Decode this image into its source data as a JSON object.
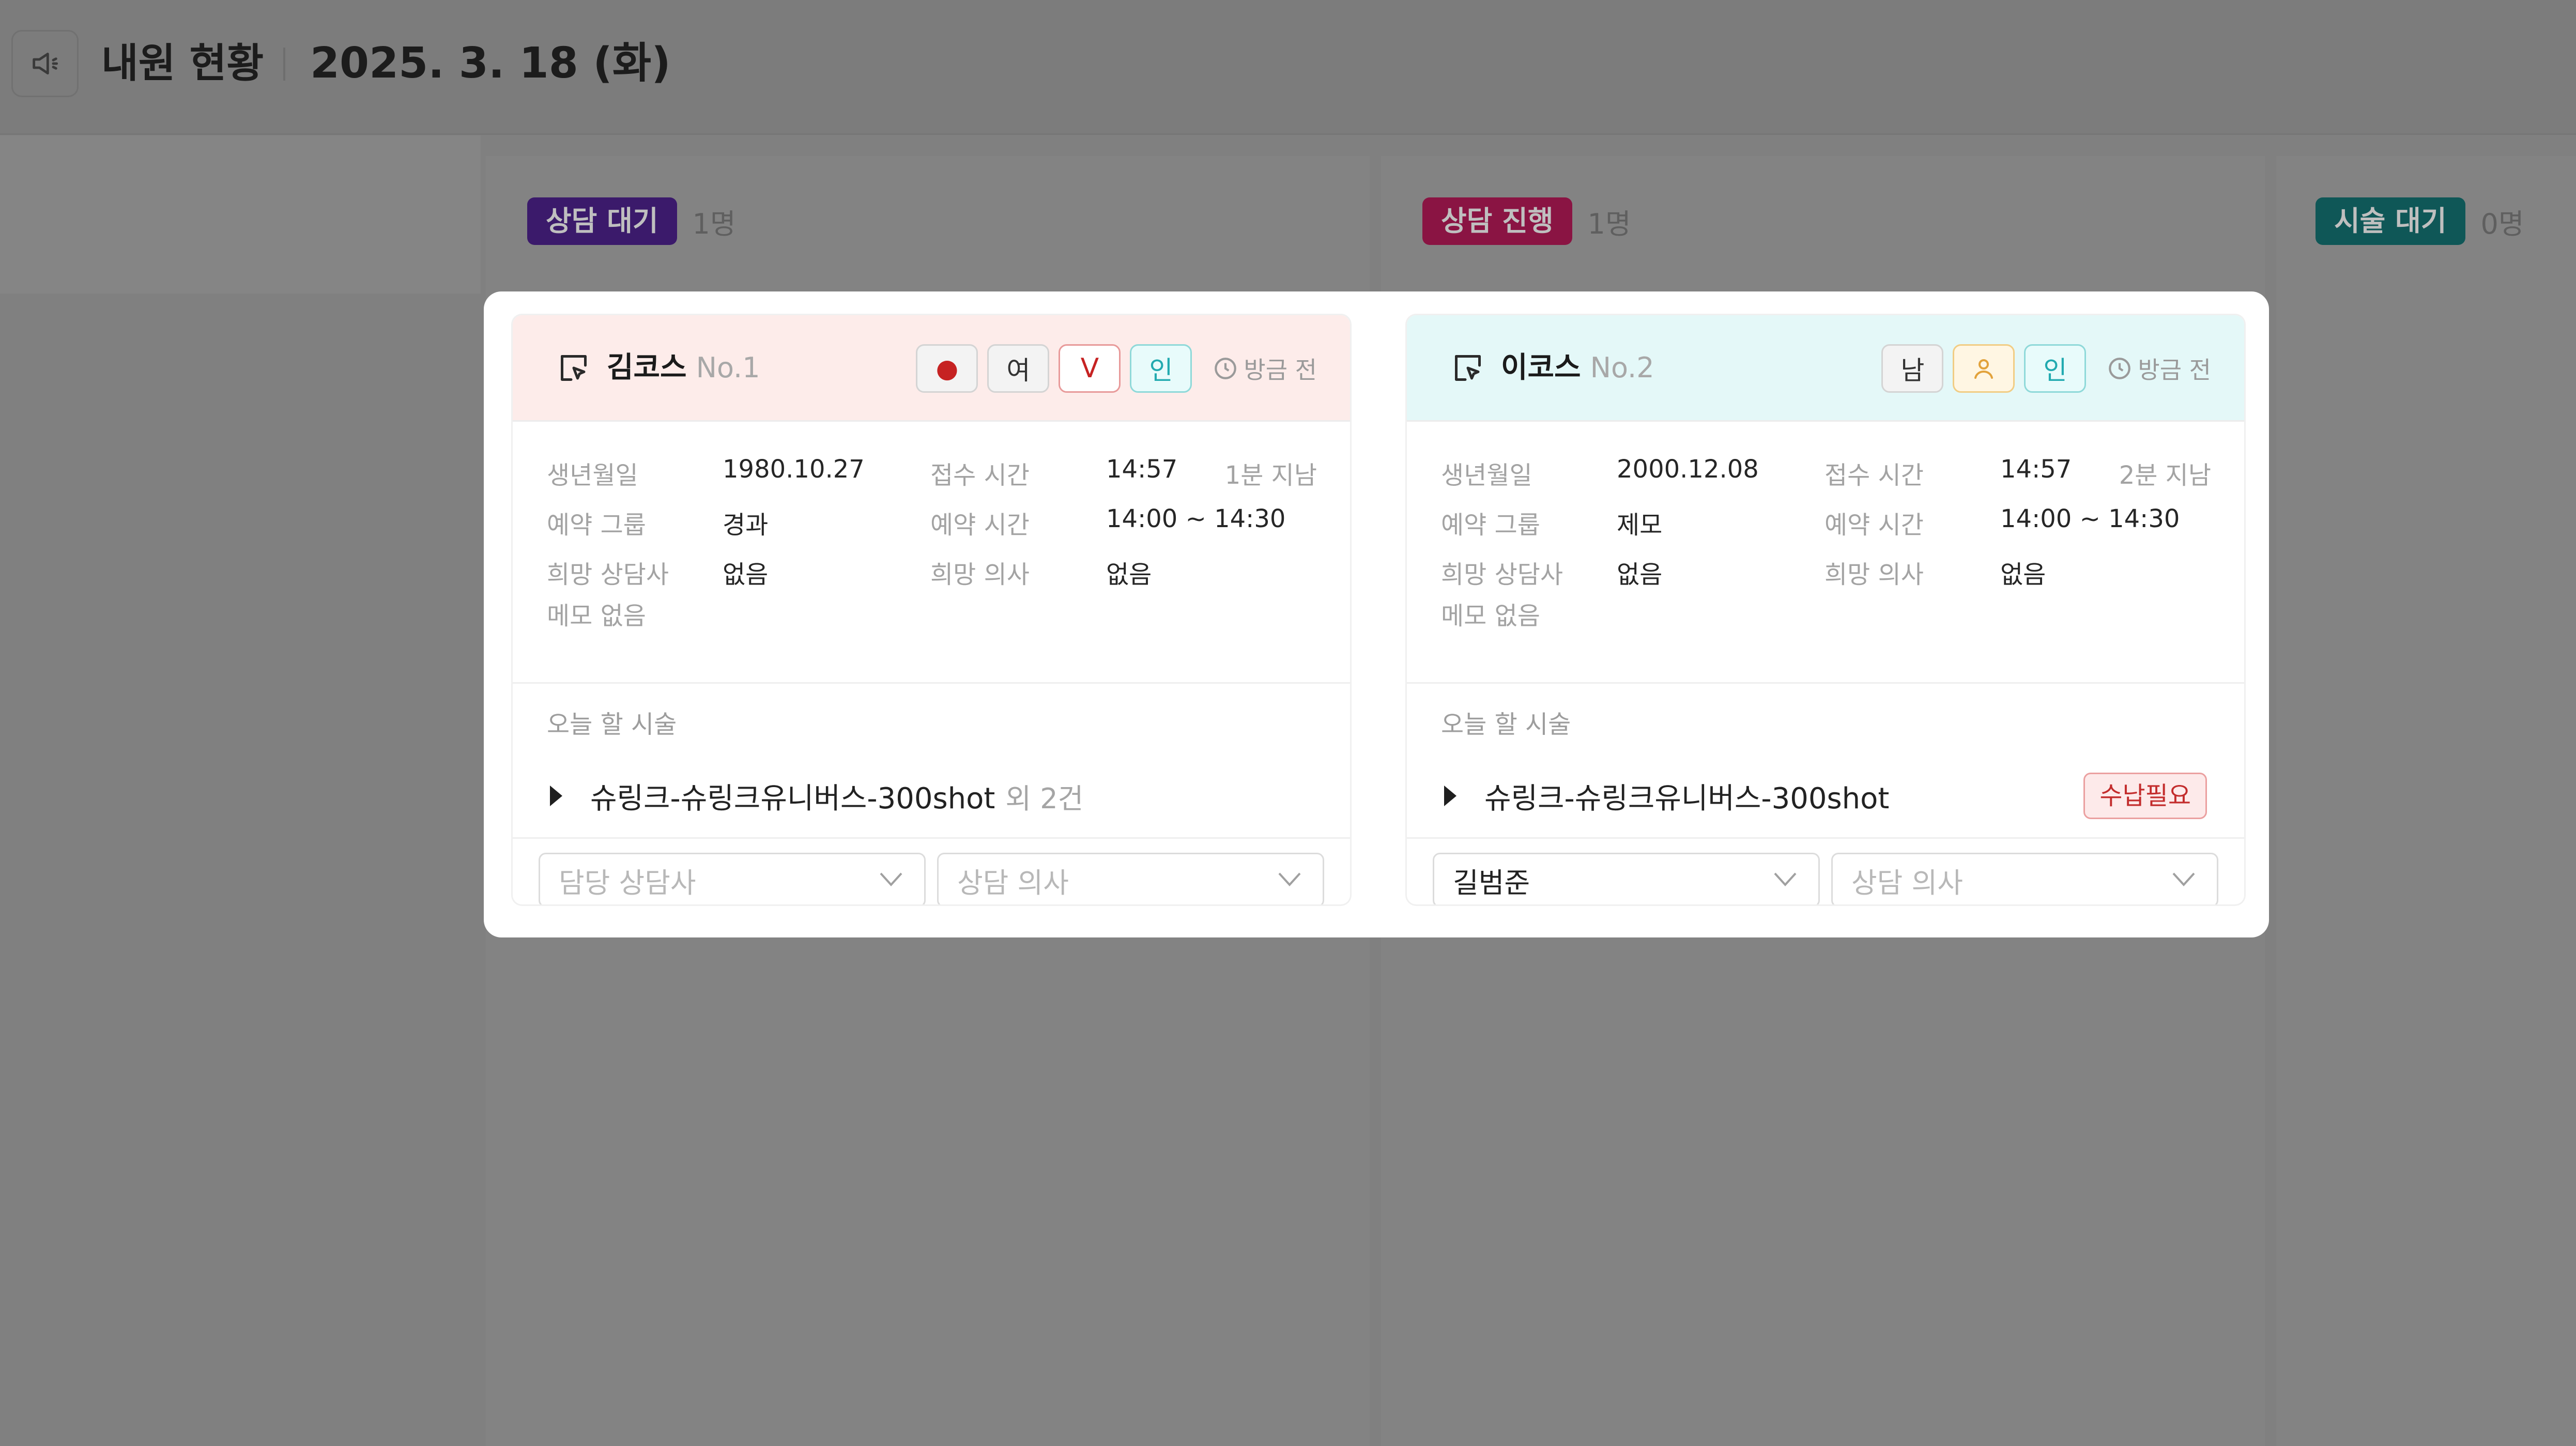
{
  "header": {
    "title": "내원 현황",
    "date": "2025. 3. 18 (화)"
  },
  "columns": [
    {
      "status": "상담 대기",
      "count": "1명",
      "color": "#3b1a6b"
    },
    {
      "status": "상담 진행",
      "count": "1명",
      "color": "#8a1443"
    },
    {
      "status": "시술 대기",
      "count": "0명",
      "color": "#0f5757"
    }
  ],
  "cards": [
    {
      "name": "김코스",
      "no": "No.1",
      "tags": [
        "●",
        "여",
        "V",
        "인"
      ],
      "time_ago": "방금 전",
      "birth_label": "생년월일",
      "birth": "1980.10.27",
      "receipt_label": "접수 시간",
      "receipt": "14:57",
      "receipt_elapsed": "1분 지남",
      "group_label": "예약 그룹",
      "group": "경과",
      "reserve_label": "예약 시간",
      "reserve": "14:00 ~ 14:30",
      "counselor_label": "희망 상담사",
      "counselor": "없음",
      "doctor_label": "희망 의사",
      "doctor": "없음",
      "memo": "메모 없음",
      "today_label": "오늘 할 시술",
      "procedure": "슈링크-슈링크유니버스-300shot",
      "procedure_extra": "외 2건",
      "select_counselor": "담당 상담사",
      "select_doctor": "상담 의사"
    },
    {
      "name": "이코스",
      "no": "No.2",
      "tags": [
        "남",
        "person",
        "인"
      ],
      "time_ago": "방금 전",
      "birth_label": "생년월일",
      "birth": "2000.12.08",
      "receipt_label": "접수 시간",
      "receipt": "14:57",
      "receipt_elapsed": "2분 지남",
      "group_label": "예약 그룹",
      "group": "제모",
      "reserve_label": "예약 시간",
      "reserve": "14:00 ~ 14:30",
      "counselor_label": "희망 상담사",
      "counselor": "없음",
      "doctor_label": "희망 의사",
      "doctor": "없음",
      "memo": "메모 없음",
      "today_label": "오늘 할 시술",
      "procedure": "슈링크-슈링크유니버스-300shot",
      "payment_badge": "수납필요",
      "select_counselor": "길범준",
      "select_doctor": "상담 의사"
    }
  ],
  "icons": {
    "speaker": "speaker-icon",
    "cursor": "cursor-select-icon",
    "clock": "clock-icon",
    "chevron": "chevron-down-icon",
    "person": "person-icon"
  }
}
